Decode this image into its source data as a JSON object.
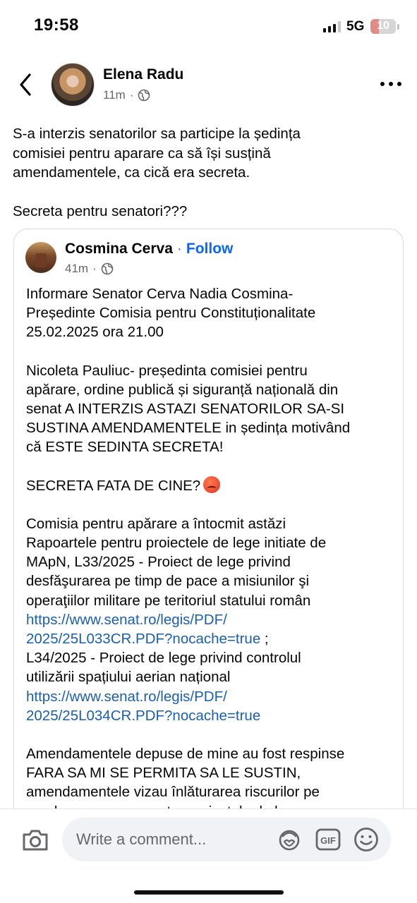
{
  "status_bar": {
    "time": "19:58",
    "network": "5G",
    "battery": "10",
    "battery_level": 0.1,
    "signal_bars_active": 3
  },
  "post": {
    "author": "Elena Radu",
    "time": "11m",
    "privacy_icon": "globe-icon",
    "text_paragraphs": [
      "S-a interzis senatorilor sa participe la ședința\ncomisiei pentru aparare ca să își susțină\namendamentele, ca cică era secreta.",
      "Secreta pentru senatori???"
    ]
  },
  "shared_post": {
    "author": "Cosmina Cerva",
    "separator": "·",
    "follow_label": "Follow",
    "time": "41m",
    "privacy_icon": "globe-icon",
    "paragraph1": "Informare Senator Cerva Nadia Cosmina-\nPreședinte Comisia pentru Constituționalitate\n25.02.2025 ora 21.00",
    "paragraph2": "Nicoleta Pauliuc- președinta comisiei pentru\napărare, ordine publică și siguranță națională din\nsenat A INTERZIS ASTAZI SENATORILOR SA-SI\nSUSTINA AMENDAMENTELE in ședința motivând\ncă ESTE SEDINTA SECRETA!",
    "paragraph3": "SECRETA FATA DE CINE?",
    "paragraph3_emoji": "angry-face-emoji",
    "paragraph4_text1": "Comisia pentru apărare a întocmit astăzi\nRapoartele pentru proiectele de lege initiate de\nMApN, L33/2025 - Proiect de lege privind\ndesfăşurarea pe timp de pace a misiunilor şi\noperaţiilor militare pe teritoriul statului român\n",
    "link1": "https://www.senat.ro/legis/PDF/\n2025/25L033CR.PDF?nocache=true",
    "paragraph4_text2": " ;\nL34/2025 - Proiect de lege privind controlul\nutilizării spațiului aerian național\n",
    "link2": "https://www.senat.ro/legis/PDF/\n2025/25L034CR.PDF?nocache=true",
    "paragraph5": "Amendamentele depuse de mine au fost respinse\nFARA SA MI SE PERMITA SA LE SUSTIN,\namendamentele  vizau înlăturarea riscurilor pe\npe plan european pentru proiectele de lege"
  },
  "comment_bar": {
    "placeholder": "Write a comment...",
    "gif_label": "GIF"
  },
  "colors": {
    "follow": "#0866ff",
    "link": "#1a5fb4",
    "meta": "#65676b"
  }
}
